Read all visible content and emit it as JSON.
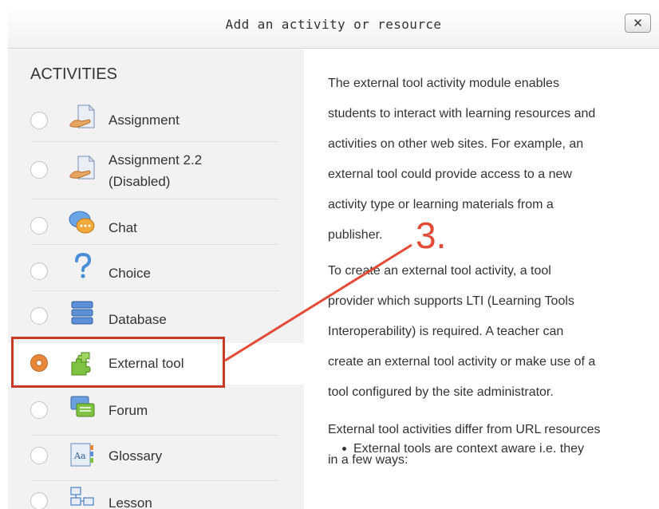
{
  "dialog": {
    "title": "Add an activity or resource",
    "close_label": "✕"
  },
  "activities": {
    "heading": "ACTIVITIES",
    "items": [
      {
        "label": "Assignment",
        "icon": "assignment-icon",
        "selected": false
      },
      {
        "label": "Assignment 2.2 (Disabled)",
        "label_line1": "Assignment 2.2",
        "label_line2": "(Disabled)",
        "icon": "assignment-icon",
        "selected": false
      },
      {
        "label": "Chat",
        "icon": "chat-icon",
        "selected": false
      },
      {
        "label": "Choice",
        "icon": "question-icon",
        "selected": false
      },
      {
        "label": "Database",
        "icon": "database-icon",
        "selected": false
      },
      {
        "label": "External tool",
        "icon": "puzzle-icon",
        "selected": true
      },
      {
        "label": "Forum",
        "icon": "forum-icon",
        "selected": false
      },
      {
        "label": "Glossary",
        "icon": "glossary-icon",
        "selected": false
      },
      {
        "label": "Lesson",
        "icon": "lesson-icon",
        "selected": false
      }
    ]
  },
  "description": {
    "p1_lines": [
      "The external tool activity module enables",
      "students to interact with learning resources and",
      "activities on other web sites. For example, an",
      "external tool could provide access to a new",
      "activity type or learning materials from a",
      "publisher."
    ],
    "p2_lines": [
      "To create an external tool activity, a tool",
      "provider which supports LTI (Learning Tools",
      "Interoperability) is required. A teacher can",
      "create an external tool activity or make use of a",
      "tool configured by the site administrator."
    ],
    "p3_lines": [
      "External tool activities differ from URL resources",
      "in a few ways:"
    ],
    "bullet": "External tools are context aware i.e. they"
  },
  "annotation": {
    "step": "3.",
    "color": "#e34a35"
  },
  "colors": {
    "selected_radio": "#e8873a",
    "highlight_border": "#c73a25"
  }
}
